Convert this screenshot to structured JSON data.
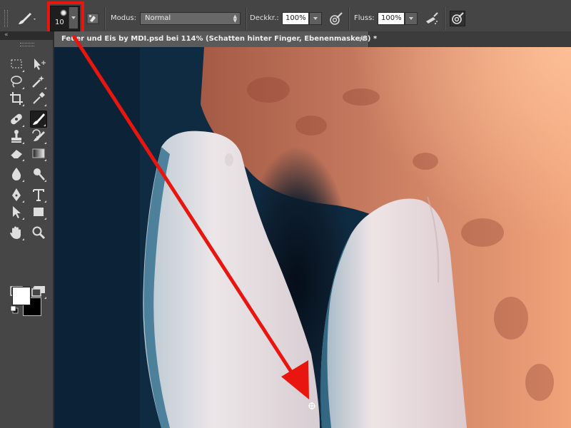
{
  "options_bar": {
    "brush_size": "10",
    "mode_label": "Modus:",
    "mode_value": "Normal",
    "opacity_label": "Deckkr.:",
    "opacity_value": "100%",
    "flow_label": "Fluss:",
    "flow_value": "100%"
  },
  "document_tab": {
    "title": "Feuer und Eis by MDI.psd bei 114% (Schatten hinter Finger, Ebenenmaske/8) *",
    "close_glyph": "×"
  },
  "toolbar": {
    "collapse_glyph": "«"
  },
  "colors": {
    "highlight": "#e8160e",
    "foreground": "#ffffff",
    "background": "#000000"
  }
}
